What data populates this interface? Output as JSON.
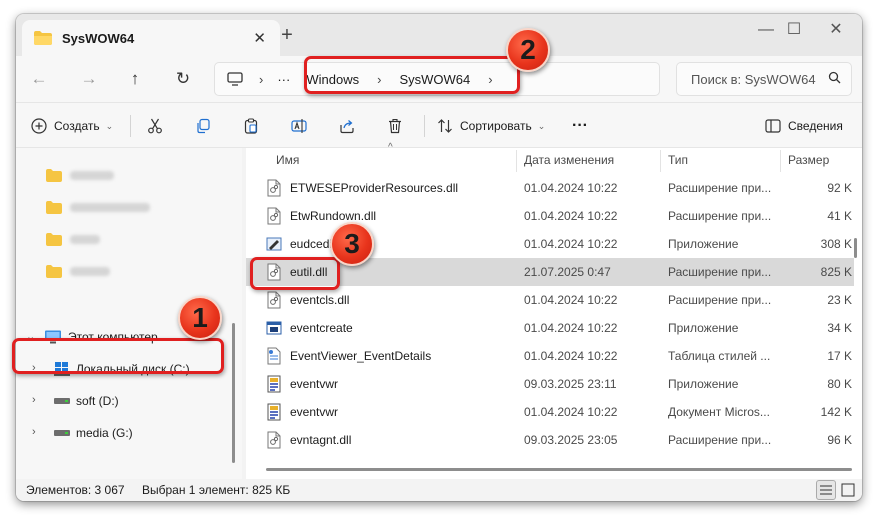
{
  "window": {
    "tab_title": "SysWOW64",
    "tab_close": "✕",
    "new_tab": "+",
    "minimize": "—",
    "maximize": "☐",
    "close": "✕"
  },
  "address": {
    "more": "···",
    "crumbs": [
      "Windows",
      "SysWOW64"
    ],
    "search_placeholder": "Поиск в: SysWOW64"
  },
  "toolbar": {
    "create_label": "Создать",
    "sort_label": "Сортировать",
    "more": "···",
    "details_label": "Сведения"
  },
  "navpane": {
    "this_pc": "Этот компьютер",
    "drives": [
      {
        "label": "Локальный диск (C:)"
      },
      {
        "label": "soft (D:)"
      },
      {
        "label": "media (G:)"
      }
    ]
  },
  "columns": {
    "name": "Имя",
    "date": "Дата изменения",
    "type": "Тип",
    "size": "Размер"
  },
  "files": [
    {
      "name": "ETWESEProviderResources.dll",
      "date": "01.04.2024 10:22",
      "type": "Расширение при...",
      "size": "92 K",
      "icon": "dll-icon"
    },
    {
      "name": "EtwRundown.dll",
      "date": "01.04.2024 10:22",
      "type": "Расширение при...",
      "size": "41 K",
      "icon": "dll-icon"
    },
    {
      "name": "eudcedit",
      "date": "01.04.2024 10:22",
      "type": "Приложение",
      "size": "308 K",
      "icon": "app-pen-icon"
    },
    {
      "name": "eutil.dll",
      "date": "21.07.2025 0:47",
      "type": "Расширение при...",
      "size": "825 K",
      "icon": "dll-icon"
    },
    {
      "name": "eventcls.dll",
      "date": "01.04.2024 10:22",
      "type": "Расширение при...",
      "size": "23 K",
      "icon": "dll-icon"
    },
    {
      "name": "eventcreate",
      "date": "01.04.2024 10:22",
      "type": "Приложение",
      "size": "34 K",
      "icon": "app-window-icon"
    },
    {
      "name": "EventViewer_EventDetails",
      "date": "01.04.2024 10:22",
      "type": "Таблица стилей ...",
      "size": "17 K",
      "icon": "stylesheet-icon"
    },
    {
      "name": "eventvwr",
      "date": "09.03.2025 23:11",
      "type": "Приложение",
      "size": "80 K",
      "icon": "event-viewer-icon"
    },
    {
      "name": "eventvwr",
      "date": "01.04.2024 10:22",
      "type": "Документ Micros...",
      "size": "142 K",
      "icon": "event-viewer-icon"
    },
    {
      "name": "evntagnt.dll",
      "date": "09.03.2025 23:05",
      "type": "Расширение при...",
      "size": "96 K",
      "icon": "dll-icon"
    }
  ],
  "selected_index": 3,
  "status": {
    "count": "Элементов: 3 067",
    "selection": "Выбран 1 элемент: 825 КБ"
  },
  "callouts": [
    "1",
    "2",
    "3"
  ],
  "colors": {
    "accent_red": "#e02020",
    "selected_row": "#d9d9d9",
    "folder_yellow": "#f5c542"
  }
}
